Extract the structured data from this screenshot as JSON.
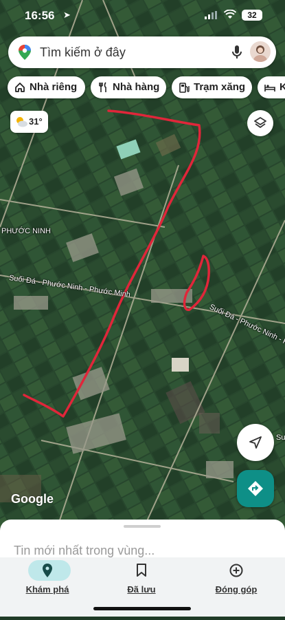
{
  "status_bar": {
    "time": "16:56",
    "battery": "32"
  },
  "search": {
    "placeholder": "Tìm kiếm ở đây"
  },
  "chips": [
    {
      "label": "Nhà riêng",
      "icon": "home-icon"
    },
    {
      "label": "Nhà hàng",
      "icon": "restaurant-icon"
    },
    {
      "label": "Trạm xăng",
      "icon": "gas-station-icon"
    },
    {
      "label": "K",
      "icon": "hotel-icon"
    }
  ],
  "weather": {
    "temperature": "31°",
    "icon": "partly-cloudy-icon"
  },
  "map": {
    "labels": [
      "PHƯỚC NINH",
      "Suối Đá - Phước Ninh - Phước Minh",
      "Suối Đá - Phước Ninh - Phư",
      "Su"
    ],
    "attribution": "Google"
  },
  "sheet": {
    "title": "Tin mới nhất trong vùng..."
  },
  "bottom_nav": [
    {
      "label": "Khám phá",
      "icon": "explore-pin-icon",
      "active": true
    },
    {
      "label": "Đã lưu",
      "icon": "bookmark-icon",
      "active": false
    },
    {
      "label": "Đóng góp",
      "icon": "add-circle-icon",
      "active": false
    }
  ],
  "colors": {
    "accent": "#0e8f87",
    "active_pill": "#bfe8ea",
    "drawing": "#e0263a"
  }
}
